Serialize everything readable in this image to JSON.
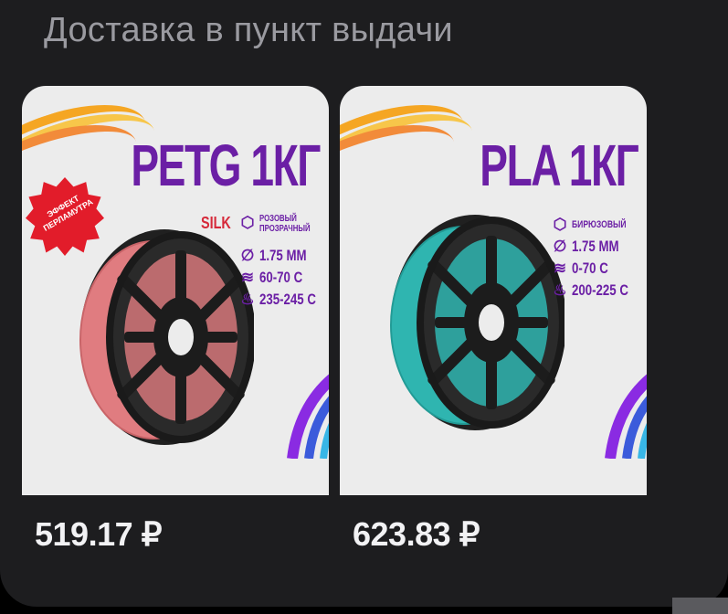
{
  "section": {
    "title": "Доставка в пункт выдачи"
  },
  "products": [
    {
      "title": "PETG 1КГ",
      "badge": "ЭФФЕКТ ПЕРЛАМУТРА",
      "finish": "SILK",
      "color": "РОЗОВЫЙ ПРОЗРАЧНЫЙ",
      "diameter": "1.75 ММ",
      "bed_temp": "60-70 С",
      "nozzle_temp": "235-245 С",
      "price": "519.17 ₽",
      "filament_color": "#e07c80"
    },
    {
      "title": "PLA 1КГ",
      "color": "БИРЮЗОВЫЙ",
      "diameter": "1.75 ММ",
      "bed_temp": "0-70 С",
      "nozzle_temp": "200-225 С",
      "price": "623.83 ₽",
      "filament_color": "#2fb5b0"
    }
  ],
  "colors": {
    "background": "#1d1d1f",
    "title_purple": "#6b1fa5",
    "price_text": "#f2f2f4",
    "muted_text": "#9a9aa0"
  },
  "icons": [
    "color-swatch-icon",
    "diameter-icon",
    "heat-icon",
    "thermometer-icon"
  ]
}
